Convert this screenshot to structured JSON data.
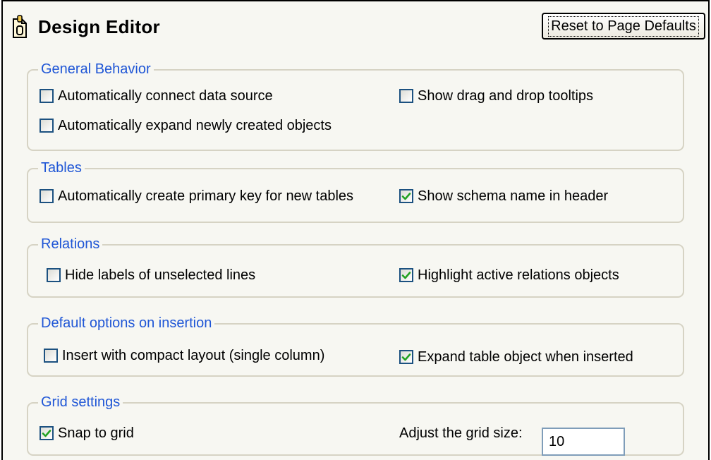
{
  "header": {
    "title": "Design Editor",
    "icon": "document-icon",
    "reset_label": "Reset to Page Defaults"
  },
  "groups": {
    "general": {
      "legend": "General Behavior",
      "auto_connect": {
        "label": "Automatically connect data source",
        "checked": false
      },
      "auto_expand": {
        "label": "Automatically expand newly created objects",
        "checked": false
      },
      "drag_tooltips": {
        "label": "Show drag and drop tooltips",
        "checked": false
      }
    },
    "tables": {
      "legend": "Tables",
      "primary_key": {
        "label": "Automatically create primary key for new tables",
        "checked": false
      },
      "schema_name": {
        "label": "Show schema name in header",
        "checked": true
      }
    },
    "relations": {
      "legend": "Relations",
      "hide_labels": {
        "label": "Hide labels of unselected lines",
        "checked": false
      },
      "highlight": {
        "label": "Highlight active relations objects",
        "checked": true
      }
    },
    "insertion": {
      "legend": "Default options on insertion",
      "compact": {
        "label": "Insert with compact layout (single column)",
        "checked": false
      },
      "expand_table": {
        "label": "Expand table object when inserted",
        "checked": true
      }
    },
    "grid": {
      "legend": "Grid settings",
      "snap": {
        "label": "Snap to grid",
        "checked": true
      },
      "size_label": "Adjust the grid size:",
      "size_value": "10"
    }
  },
  "colors": {
    "legend": "#1f56d6",
    "check": "#21a121",
    "checkbox_border": "#1c5180",
    "group_border": "#d6d3c4",
    "background": "#f7f7f2"
  }
}
